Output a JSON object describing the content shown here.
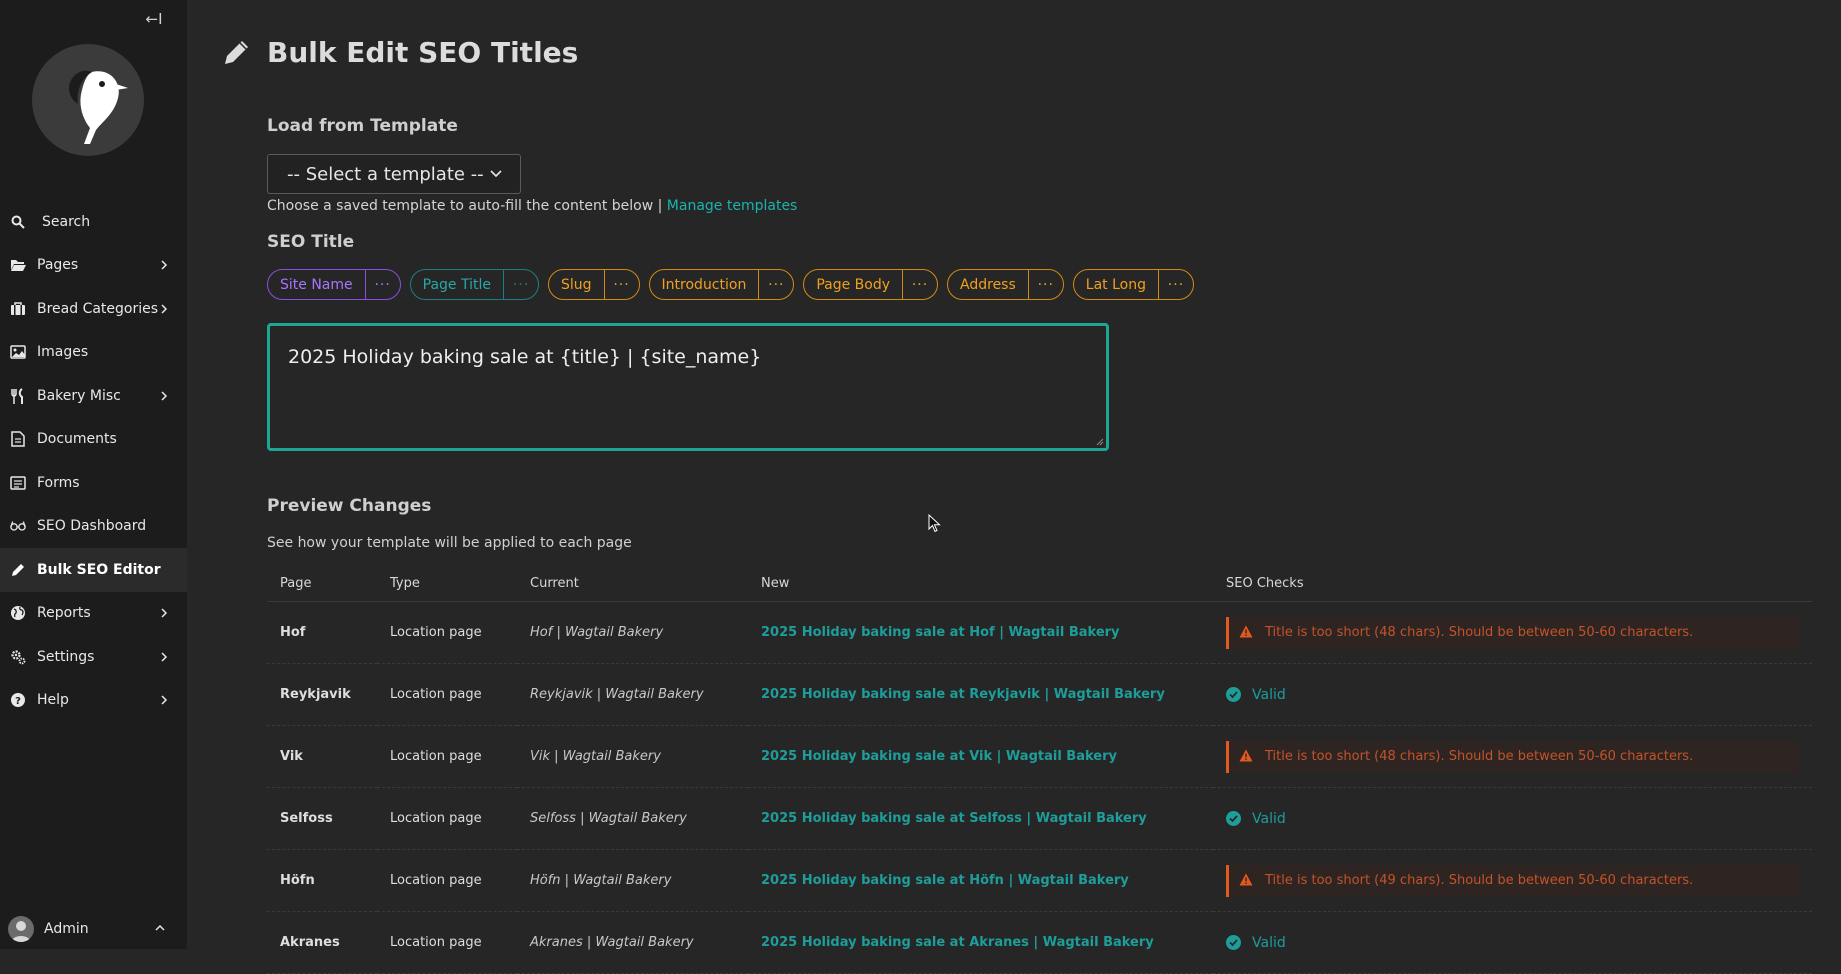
{
  "sidebar": {
    "collapse_label": "←I",
    "items": [
      {
        "label": "Search",
        "icon": "search-icon"
      },
      {
        "label": "Pages",
        "icon": "folder-open-icon",
        "has_children": true
      },
      {
        "label": "Bread Categories",
        "icon": "suitcase-icon",
        "has_children": true
      },
      {
        "label": "Images",
        "icon": "image-icon"
      },
      {
        "label": "Bakery Misc",
        "icon": "utensils-icon",
        "has_children": true
      },
      {
        "label": "Documents",
        "icon": "document-icon"
      },
      {
        "label": "Forms",
        "icon": "form-icon"
      },
      {
        "label": "SEO Dashboard",
        "icon": "glasses-icon"
      },
      {
        "label": "Bulk SEO Editor",
        "icon": "pencil-icon",
        "active": true
      },
      {
        "label": "Reports",
        "icon": "globe-icon",
        "has_children": true
      },
      {
        "label": "Settings",
        "icon": "cogs-icon",
        "has_children": true
      },
      {
        "label": "Help",
        "icon": "help-icon",
        "has_children": true
      }
    ],
    "account_label": "Admin"
  },
  "header": {
    "title": "Bulk Edit SEO Titles"
  },
  "template": {
    "label": "Load from Template",
    "select_value": "-- Select a template --",
    "help_text": "Choose a saved template to auto-fill the content below |",
    "help_link": "Manage templates"
  },
  "seo_title": {
    "label": "SEO Title",
    "chips": [
      {
        "label": "Site Name",
        "more": "···",
        "color": "#8b4ee0"
      },
      {
        "label": "Page Title",
        "more": "···",
        "color": "#1b7f82"
      },
      {
        "label": "Slug",
        "more": "···",
        "color": "#d48a12"
      },
      {
        "label": "Introduction",
        "more": "···",
        "color": "#d48a12"
      },
      {
        "label": "Page Body",
        "more": "···",
        "color": "#d48a12"
      },
      {
        "label": "Address",
        "more": "···",
        "color": "#d48a12"
      },
      {
        "label": "Lat Long",
        "more": "···",
        "color": "#d48a12"
      }
    ],
    "value": "2025 Holiday baking sale at {title} | {site_name}"
  },
  "preview": {
    "title": "Preview Changes",
    "subtitle": "See how your template will be applied to each page",
    "columns": [
      "Page",
      "Type",
      "Current",
      "New",
      "SEO Checks"
    ],
    "rows": [
      {
        "page": "Hof",
        "type": "Location page",
        "current": "Hof | Wagtail Bakery",
        "new": "2025 Holiday baking sale at Hof | Wagtail Bakery",
        "check": "Title is too short (48 chars). Should be between 50-60 characters.",
        "status": "warning"
      },
      {
        "page": "Reykjavik",
        "type": "Location page",
        "current": "Reykjavik | Wagtail Bakery",
        "new": "2025 Holiday baking sale at Reykjavik | Wagtail Bakery",
        "check": "Valid",
        "status": "valid"
      },
      {
        "page": "Vik",
        "type": "Location page",
        "current": "Vik | Wagtail Bakery",
        "new": "2025 Holiday baking sale at Vik | Wagtail Bakery",
        "check": "Title is too short (48 chars). Should be between 50-60 characters.",
        "status": "warning"
      },
      {
        "page": "Selfoss",
        "type": "Location page",
        "current": "Selfoss | Wagtail Bakery",
        "new": "2025 Holiday baking sale at Selfoss | Wagtail Bakery",
        "check": "Valid",
        "status": "valid"
      },
      {
        "page": "Höfn",
        "type": "Location page",
        "current": "Höfn | Wagtail Bakery",
        "new": "2025 Holiday baking sale at Höfn | Wagtail Bakery",
        "check": "Title is too short (49 chars). Should be between 50-60 characters.",
        "status": "warning"
      },
      {
        "page": "Akranes",
        "type": "Location page",
        "current": "Akranes | Wagtail Bakery",
        "new": "2025 Holiday baking sale at Akranes | Wagtail Bakery",
        "check": "Valid",
        "status": "valid"
      }
    ]
  },
  "colors": {
    "accent": "#1fa594",
    "warning": "#e45a1e",
    "valid": "#1d9e9a"
  }
}
